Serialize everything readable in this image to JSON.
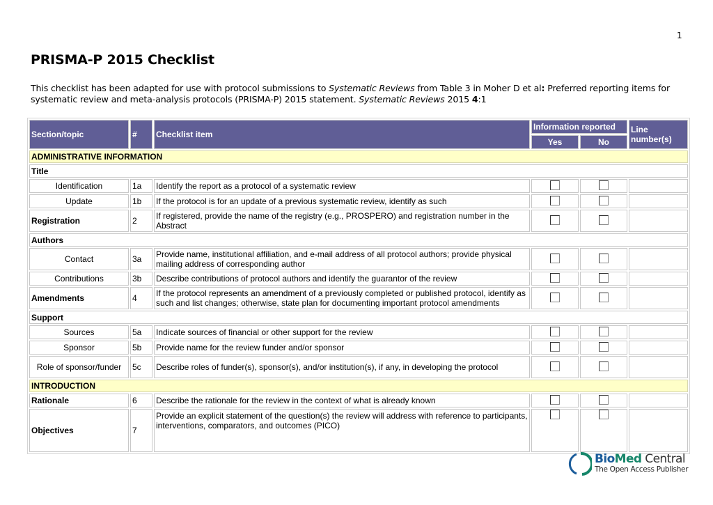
{
  "page_number": "1",
  "title": "PRISMA-P 2015 Checklist",
  "intro": {
    "part1": "This checklist has been adapted for use with protocol submissions to ",
    "journal": "Systematic Reviews",
    "part2": " from Table 3 in Moher D et al",
    "colon": ":",
    "part3": " Preferred reporting items for systematic review and meta-analysis protocols (PRISMA-P) 2015 statement. ",
    "journal2": "Systematic Reviews",
    "part4": " 2015 ",
    "volume": "4",
    "part5": ":1"
  },
  "table": {
    "headers": {
      "section_topic": "Section/topic",
      "number": "#",
      "checklist_item": "Checklist item",
      "information_reported": "Information reported",
      "yes": "Yes",
      "no": "No",
      "line_numbers": "Line number(s)"
    },
    "sections": {
      "admin": "ADMINISTRATIVE INFORMATION",
      "introduction": "INTRODUCTION"
    },
    "subheads": {
      "title": "Title",
      "authors": "Authors",
      "support": "Support"
    },
    "rows": [
      {
        "topic": "Identification",
        "num": "1a",
        "text": "Identify the report as a protocol of a systematic review",
        "yes": false,
        "no": false,
        "line": ""
      },
      {
        "topic": "Update",
        "num": "1b",
        "text": "If the protocol is for an update of a previous systematic review, identify as such",
        "yes": false,
        "no": false,
        "line": ""
      },
      {
        "topic": "Registration",
        "num": "2",
        "text": "If registered, provide the name of the registry (e.g., PROSPERO) and registration number in the Abstract",
        "yes": false,
        "no": false,
        "line": ""
      },
      {
        "topic": "Contact",
        "num": "3a",
        "text": "Provide name, institutional affiliation, and e-mail address of all protocol authors; provide physical mailing address of corresponding author",
        "yes": false,
        "no": false,
        "line": ""
      },
      {
        "topic": "Contributions",
        "num": "3b",
        "text": "Describe contributions of protocol authors and identify the guarantor of the review",
        "yes": false,
        "no": false,
        "line": ""
      },
      {
        "topic": "Amendments",
        "num": "4",
        "text": "If the protocol represents an amendment of a previously completed or published protocol, identify as such and list changes; otherwise, state plan for documenting important protocol amendments",
        "yes": false,
        "no": false,
        "line": ""
      },
      {
        "topic": "Sources",
        "num": "5a",
        "text": "Indicate sources of financial or other support for the review",
        "yes": false,
        "no": false,
        "line": ""
      },
      {
        "topic": "Sponsor",
        "num": "5b",
        "text": "Provide name for the review funder and/or sponsor",
        "yes": false,
        "no": false,
        "line": ""
      },
      {
        "topic": "Role of sponsor/funder",
        "num": "5c",
        "text": "Describe roles of funder(s), sponsor(s), and/or institution(s), if any, in developing the protocol",
        "yes": false,
        "no": false,
        "line": ""
      },
      {
        "topic": "Rationale",
        "num": "6",
        "text": "Describe the rationale for the review in the context of what is already known",
        "yes": false,
        "no": false,
        "line": ""
      },
      {
        "topic": "Objectives",
        "num": "7",
        "text": "Provide an explicit statement of the question(s) the review will address with reference to participants, interventions, comparators, and outcomes (PICO)",
        "yes": false,
        "no": false,
        "line": ""
      }
    ]
  },
  "logo": {
    "bio": "Bio",
    "med": "Med",
    "central": " Central",
    "tagline": "The Open Access Publisher",
    "colors": {
      "blue": "#1c5d9b",
      "green": "#16866a"
    }
  },
  "colors": {
    "header_bg": "#605e96",
    "section_bg": "#ffffc8"
  }
}
